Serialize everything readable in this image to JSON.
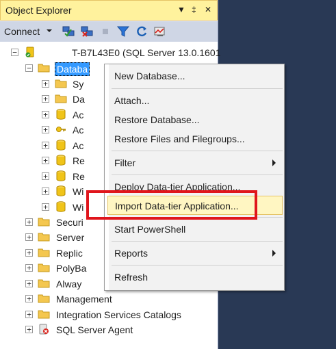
{
  "panel": {
    "title": "Object Explorer",
    "title_buttons": {
      "dropdown": "▼",
      "pin": "‡",
      "close": "✕"
    },
    "colors": {
      "title_bg": "#fff29d",
      "toolbar_bg": "#cfd6e5",
      "backdrop": "#293955",
      "selected": "#3399ff",
      "highlight_border": "#e0151c"
    }
  },
  "toolbar": {
    "connect_label": "Connect",
    "icons": [
      "connect-object-explorer-icon",
      "disconnect-icon",
      "stop-icon",
      "filter-icon",
      "refresh-icon",
      "activity-monitor-icon"
    ]
  },
  "tree": {
    "server": "T-B7L43E0 (SQL Server 13.0.1601",
    "databases": "Databa",
    "db_children": [
      "Sy",
      "Da",
      "Ac",
      "Ac",
      "Ac",
      "Re",
      "Re",
      "Wi",
      "Wi"
    ],
    "others": [
      {
        "label": "Securi"
      },
      {
        "label": "Server"
      },
      {
        "label": "Replic"
      },
      {
        "label": "PolyBa"
      },
      {
        "label": "Alway"
      },
      {
        "label": "Management"
      },
      {
        "label": "Integration Services Catalogs"
      },
      {
        "label": "SQL Server Agent"
      }
    ]
  },
  "context_menu": {
    "items": [
      {
        "label": "New Database..."
      },
      {
        "label": "Attach..."
      },
      {
        "label": "Restore Database..."
      },
      {
        "label": "Restore Files and Filegroups..."
      },
      {
        "label": "Filter"
      },
      {
        "label": "Deploy Data-tier Application..."
      },
      {
        "label": "Import Data-tier Application..."
      },
      {
        "label": "Start PowerShell"
      },
      {
        "label": "Reports"
      },
      {
        "label": "Refresh"
      }
    ]
  }
}
